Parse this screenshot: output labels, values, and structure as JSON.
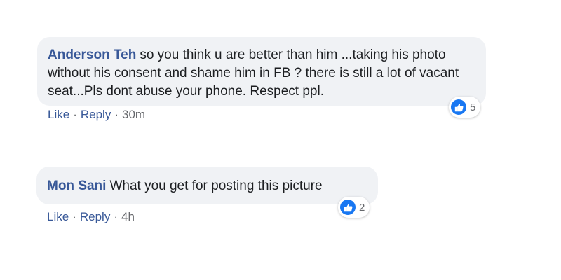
{
  "comments": [
    {
      "author": "Anderson Teh",
      "text": "so you think u are better than him ...taking his photo without his consent and shame him in FB ? there is still a lot of vacant seat...Pls dont abuse your phone. Respect ppl.",
      "like_label": "Like",
      "reply_label": "Reply",
      "separator": "·",
      "time": "30m",
      "reaction_count": "5"
    },
    {
      "author": "Mon Sani",
      "text": "What you get for posting this picture",
      "like_label": "Like",
      "reply_label": "Reply",
      "separator": "·",
      "time": "4h",
      "reaction_count": "2"
    }
  ],
  "colors": {
    "bubble_bg": "#f0f2f5",
    "author": "#385898",
    "action_link": "#385898",
    "muted": "#65676b",
    "like_blue": "#1877f2"
  },
  "icons": {
    "reaction": "thumbs-up-icon"
  }
}
